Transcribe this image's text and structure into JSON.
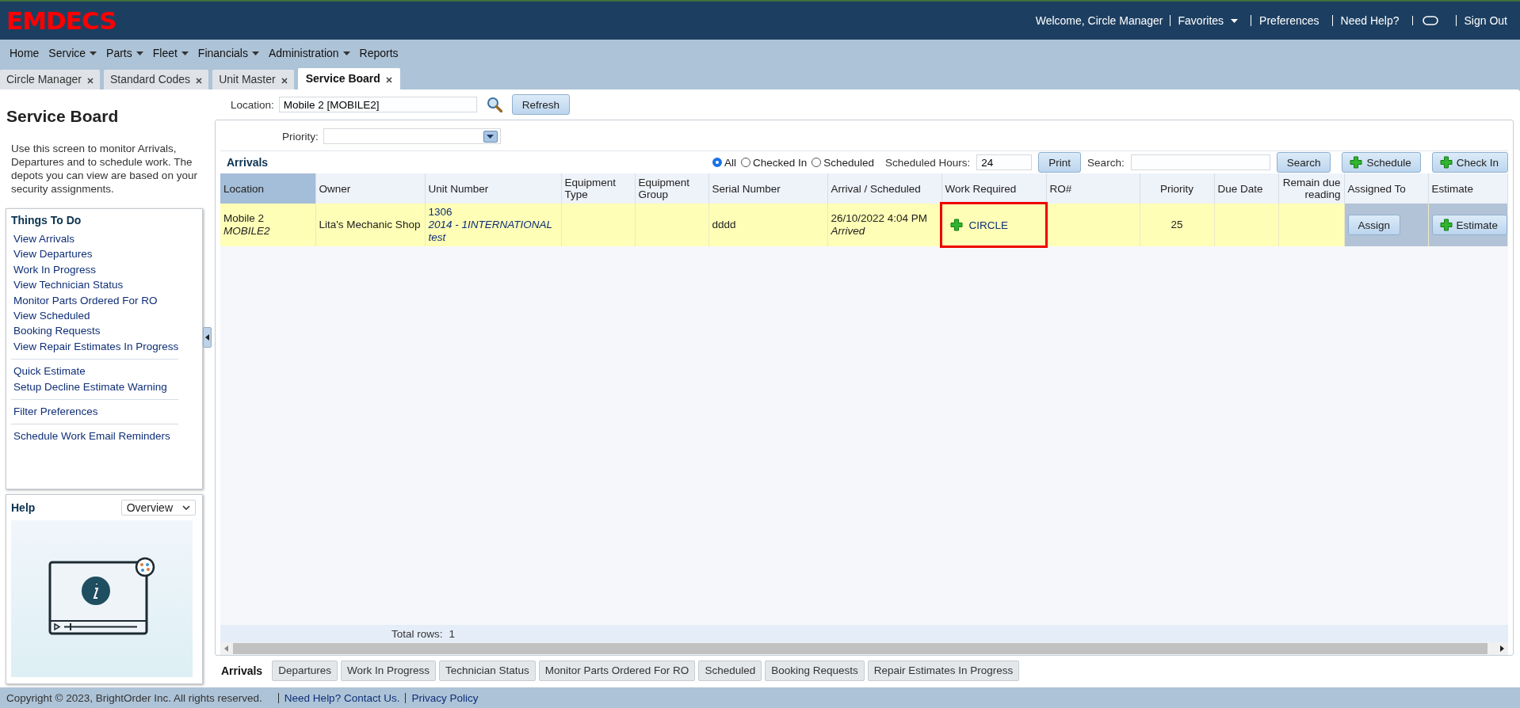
{
  "header": {
    "logo": "EMDECS",
    "welcome": "Welcome, Circle Manager",
    "links": [
      {
        "label": "Favorites",
        "kind": "dropdown"
      },
      {
        "label": "Preferences",
        "kind": "link"
      },
      {
        "label": "Need Help?",
        "kind": "link"
      },
      {
        "kind": "pill-icon"
      },
      {
        "label": "Sign Out",
        "kind": "link"
      }
    ]
  },
  "menu": [
    {
      "label": "Home",
      "dropdown": false
    },
    {
      "label": "Service",
      "dropdown": true
    },
    {
      "label": "Parts",
      "dropdown": true
    },
    {
      "label": "Fleet",
      "dropdown": true
    },
    {
      "label": "Financials",
      "dropdown": true
    },
    {
      "label": "Administration",
      "dropdown": true
    },
    {
      "label": "Reports",
      "dropdown": false
    }
  ],
  "tabs": [
    {
      "label": "Circle Manager",
      "selected": false
    },
    {
      "label": "Standard Codes",
      "selected": false
    },
    {
      "label": "Unit Master",
      "selected": false
    },
    {
      "label": "Service Board",
      "selected": true
    }
  ],
  "sidebar": {
    "title": "Service Board",
    "description": "Use this screen to monitor Arrivals, Departures and to schedule work. The depots you can view are based on your security assignments.",
    "things_to_do": {
      "title": "Things To Do",
      "groups": [
        [
          "View Arrivals",
          "View Departures",
          "Work In Progress",
          "View Technician Status",
          "Monitor Parts Ordered For RO",
          "View Scheduled",
          "Booking Requests",
          "View Repair Estimates In Progress"
        ],
        [
          "Quick Estimate",
          "Setup Decline Estimate Warning"
        ],
        [
          "Filter Preferences"
        ],
        [
          "Schedule Work Email Reminders"
        ]
      ]
    },
    "help": {
      "title": "Help",
      "select": "Overview"
    }
  },
  "filters": {
    "location_label": "Location:",
    "location": "Mobile 2 [MOBILE2]",
    "refresh": "Refresh",
    "priority_label": "Priority:"
  },
  "toolbar": {
    "title": "Arrivals",
    "radios": [
      {
        "label": "All",
        "selected": true
      },
      {
        "label": "Checked In",
        "selected": false
      },
      {
        "label": "Scheduled",
        "selected": false
      }
    ],
    "hours_label": "Scheduled Hours:",
    "hours": "24",
    "print": "Print",
    "search_label": "Search:",
    "search": "Search",
    "schedule": "Schedule",
    "check_in": "Check In"
  },
  "table": {
    "columns": [
      {
        "label": "Location",
        "sorted": true
      },
      {
        "label": "Owner",
        "sorted": false
      },
      {
        "label": "Unit Number",
        "sorted": false
      },
      {
        "label": "Equipment Type",
        "sorted": false
      },
      {
        "label": "Equipment Group",
        "sorted": false
      },
      {
        "label": "Serial Number",
        "sorted": false
      },
      {
        "label": "Arrival / Scheduled",
        "sorted": false
      },
      {
        "label": "Work Required",
        "sorted": false
      },
      {
        "label": "RO#",
        "sorted": false
      },
      {
        "label": "Priority",
        "sorted": false
      },
      {
        "label": "Due Date",
        "sorted": false
      },
      {
        "label": "Remain due reading",
        "sorted": false
      },
      {
        "label": "Assigned To",
        "sorted": false
      },
      {
        "label": "Estimate",
        "sorted": false
      }
    ],
    "rows": [
      {
        "cells": [
          {
            "kind": "text",
            "lines": [
              {
                "text": "Mobile 2",
                "italic": false
              },
              {
                "text": "MOBILE2",
                "italic": true
              }
            ]
          },
          {
            "kind": "text",
            "lines": [
              {
                "text": "Lita's Mechanic Shop",
                "italic": false
              }
            ]
          },
          {
            "kind": "link",
            "lines": [
              {
                "text": "1306",
                "italic": false
              },
              {
                "text": "2014 - 1INTERNATIONAL",
                "italic": true
              },
              {
                "text": "test",
                "italic": true
              }
            ]
          },
          {
            "kind": "text"
          },
          {
            "kind": "text"
          },
          {
            "kind": "text",
            "lines": [
              {
                "text": "dddd",
                "italic": false
              }
            ]
          },
          {
            "kind": "text",
            "lines": [
              {
                "text": "26/10/2022 4:04 PM",
                "italic": false
              },
              {
                "text": "Arrived",
                "italic": true
              }
            ]
          },
          {
            "kind": "add-link",
            "label": "CIRCLE",
            "highlighted": true
          },
          {
            "kind": "text"
          },
          {
            "kind": "text",
            "lines": [
              {
                "text": "25",
                "italic": false
              }
            ]
          },
          {
            "kind": "text"
          },
          {
            "kind": "text"
          },
          {
            "kind": "button",
            "label": "Assign"
          },
          {
            "kind": "add-button",
            "label": "Estimate"
          }
        ]
      }
    ],
    "total_label": "Total rows:",
    "total": "1"
  },
  "bottom_tabs": [
    {
      "label": "Arrivals",
      "selected": true
    },
    {
      "label": "Departures",
      "selected": false
    },
    {
      "label": "Work In Progress",
      "selected": false
    },
    {
      "label": "Technician Status",
      "selected": false
    },
    {
      "label": "Monitor Parts Ordered For RO",
      "selected": false
    },
    {
      "label": "Scheduled",
      "selected": false
    },
    {
      "label": "Booking Requests",
      "selected": false
    },
    {
      "label": "Repair Estimates In Progress",
      "selected": false
    }
  ],
  "footer": {
    "copyright": "Copyright © 2023, BrightOrder Inc. All rights reserved.",
    "links": [
      "Need Help? Contact Us.",
      "Privacy Policy"
    ]
  }
}
